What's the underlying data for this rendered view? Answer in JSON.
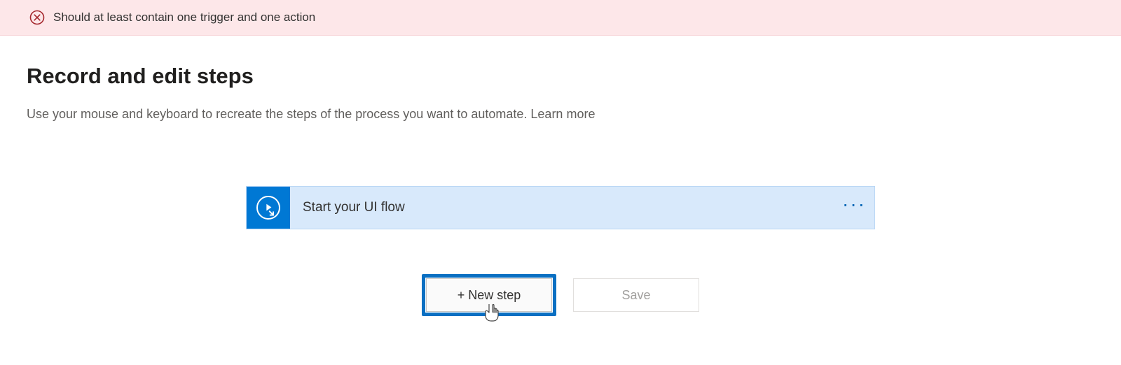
{
  "error_banner": {
    "message": "Should at least contain one trigger and one action"
  },
  "page": {
    "title": "Record and edit steps",
    "description": "Use your mouse and keyboard to recreate the steps of the process you want to automate.  ",
    "learn_more": "Learn more"
  },
  "flow_card": {
    "label": "Start your UI flow"
  },
  "buttons": {
    "new_step": "+ New step",
    "save": "Save"
  }
}
